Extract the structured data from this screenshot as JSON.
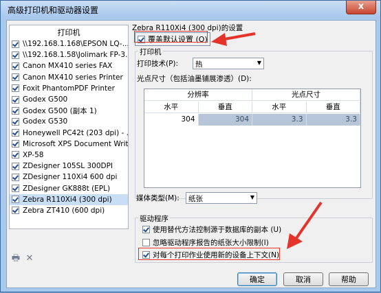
{
  "window": {
    "title": "高级打印机和驱动器设置",
    "close": "x"
  },
  "printers": {
    "header": "打印机",
    "items": [
      {
        "label": "\\\\192.168.1.168\\EPSON LQ-...",
        "checked": true
      },
      {
        "label": "\\\\192.168.1.58\\Jolimark FP-3...",
        "checked": true
      },
      {
        "label": "Canon MX410 series FAX",
        "checked": true
      },
      {
        "label": "Canon MX410 series Printer",
        "checked": true
      },
      {
        "label": "Foxit PhantomPDF Printer",
        "checked": true
      },
      {
        "label": "Godex G500",
        "checked": true
      },
      {
        "label": "Godex G500 (副本 1)",
        "checked": true
      },
      {
        "label": "Godex G530",
        "checked": true
      },
      {
        "label": "Honeywell PC42t (203 dpi) - ...",
        "checked": true
      },
      {
        "label": "Microsoft XPS Document Writer",
        "checked": true
      },
      {
        "label": "XP-58",
        "checked": true
      },
      {
        "label": "ZDesigner 105SL 300DPI",
        "checked": true
      },
      {
        "label": "ZDesigner 110Xi4 600 dpi",
        "checked": true
      },
      {
        "label": "ZDesigner GK888t (EPL)",
        "checked": true
      },
      {
        "label": "Zebra R110Xi4 (300 dpi)",
        "checked": true,
        "selected": true
      },
      {
        "label": "Zebra ZT410 (600 dpi)",
        "checked": true
      }
    ]
  },
  "device": {
    "title": "Zebra R110Xi4 (300 dpi)的设置",
    "override_label": "覆盖默认设置 (O)",
    "printer_group": "打印机",
    "tech_label": "打印技术(P):",
    "tech_value": "热",
    "dot_label": "光点尺寸（包括油墨铺展渗透）(D):",
    "table": {
      "group_headers": [
        "分辨率",
        "光点尺寸"
      ],
      "sub_headers": [
        "水平",
        "垂直",
        "水平",
        "垂直"
      ],
      "row": [
        "304",
        "304",
        "3.3",
        "3.3"
      ]
    },
    "media_label": "媒体类型(M):",
    "media_value": "纸张"
  },
  "driver": {
    "group": "驱动程序",
    "opt1": "使用替代方法控制源于数据库的副本 (U)",
    "opt2": "忽略驱动程序报告的纸张大小限制(I)",
    "opt3": "对每个打印作业使用新的设备上下文(N)"
  },
  "buttons": {
    "ok": "确定",
    "cancel": "取消",
    "help": "帮助"
  },
  "colors": {
    "annotation": "#e3332a",
    "selection": "#c7def5"
  }
}
